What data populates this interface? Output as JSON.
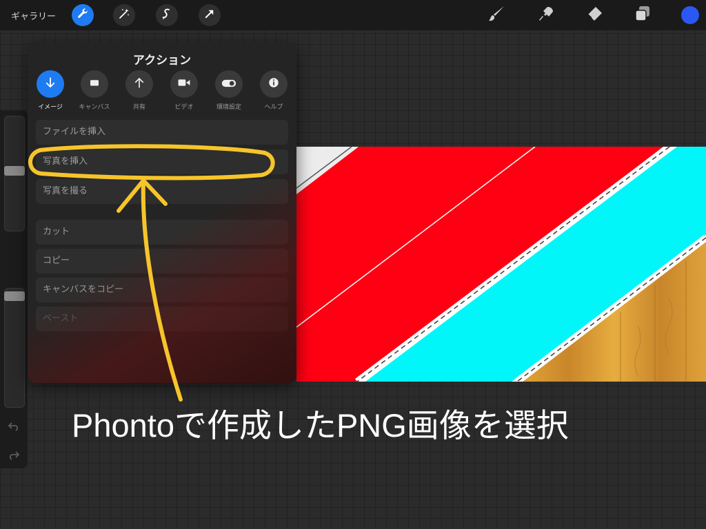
{
  "toolbar": {
    "gallery_label": "ギャラリー",
    "left_tools": [
      "wrench-icon",
      "magic-wand-icon",
      "selection-icon",
      "transform-icon"
    ],
    "right_tools": [
      "brush-icon",
      "smudge-icon",
      "eraser-icon",
      "layers-icon"
    ],
    "color": "#2b57f5",
    "accent": "#1e7bf2"
  },
  "panel": {
    "title": "アクション",
    "tabs": [
      {
        "label": "イメージ",
        "icon": "down-arrow-icon",
        "active": true
      },
      {
        "label": "キャンバス",
        "icon": "canvas-icon",
        "active": false
      },
      {
        "label": "共有",
        "icon": "up-arrow-icon",
        "active": false
      },
      {
        "label": "ビデオ",
        "icon": "video-icon",
        "active": false
      },
      {
        "label": "環境設定",
        "icon": "toggle-icon",
        "active": false
      },
      {
        "label": "ヘルプ",
        "icon": "info-icon",
        "active": false
      }
    ],
    "menu": [
      {
        "label": "ファイルを挿入",
        "enabled": true
      },
      {
        "label": "写真を挿入",
        "enabled": true
      },
      {
        "label": "写真を撮る",
        "enabled": true
      },
      {
        "label": "カット",
        "enabled": true
      },
      {
        "label": "コピー",
        "enabled": true
      },
      {
        "label": "キャンバスをコピー",
        "enabled": true
      },
      {
        "label": "ペースト",
        "enabled": false
      }
    ]
  },
  "canvas_colors": {
    "red": "#ff0013",
    "cyan": "#00f6f8",
    "wood": "#d89a2a"
  },
  "annotation": {
    "caption": "Phontoで作成したPNG画像を選択",
    "highlight_color": "#f6c42b"
  }
}
